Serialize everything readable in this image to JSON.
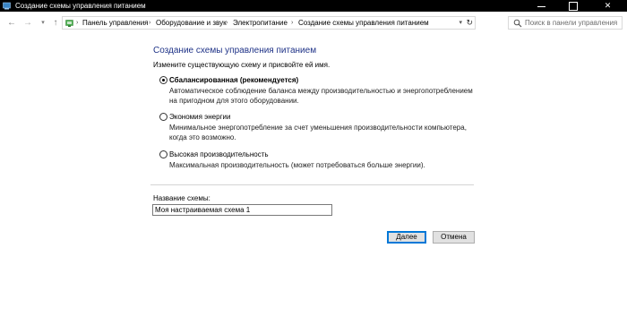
{
  "window": {
    "title": "Создание схемы управления питанием",
    "controls": {
      "minimize": "minimize",
      "maximize": "maximize",
      "close": "✕"
    }
  },
  "nav": {
    "back_icon": "back-arrow-icon",
    "forward_icon": "forward-arrow-icon",
    "recent_icon": "chevron-down-icon",
    "up_icon": "up-arrow-icon",
    "breadcrumb": [
      "Панель управления",
      "Оборудование и звук",
      "Электропитание",
      "Создание схемы управления питанием"
    ],
    "search_placeholder": "Поиск в панели управления"
  },
  "content": {
    "heading": "Создание схемы управления питанием",
    "subtitle": "Измените существующую схему и присвойте ей имя.",
    "options": [
      {
        "label": "Сбалансированная (рекомендуется)",
        "description": "Автоматическое соблюдение баланса между производительностью и энергопотреблением на пригодном для этого оборудовании.",
        "selected": true
      },
      {
        "label": "Экономия энергии",
        "description": "Минимальное энергопотребление за счет уменьшения производительности компьютера, когда это возможно.",
        "selected": false
      },
      {
        "label": "Высокая производительность",
        "description": "Максимальная производительность (может потребоваться больше энергии).",
        "selected": false
      }
    ],
    "name_label": "Название схемы:",
    "name_value": "Моя настраиваемая схема 1"
  },
  "buttons": {
    "next": "Далее",
    "cancel": "Отмена"
  },
  "colors": {
    "titlebar": "#000000",
    "heading": "#1e3287",
    "default_button_border": "#0078d7"
  }
}
